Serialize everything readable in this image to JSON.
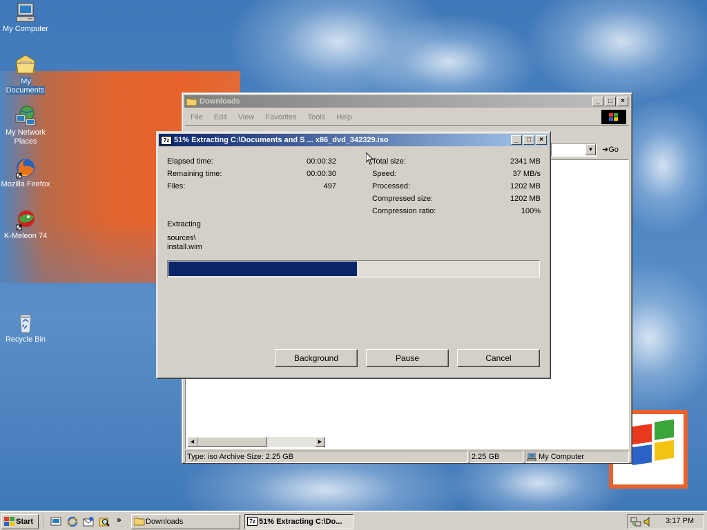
{
  "desktop": {
    "icons": [
      {
        "label": "My Computer",
        "icon": "my-computer-icon"
      },
      {
        "label": "My Documents",
        "icon": "my-documents-icon"
      },
      {
        "label": "My Network Places",
        "icon": "network-places-icon"
      },
      {
        "label": "Mozilla Firefox",
        "icon": "firefox-icon"
      },
      {
        "label": "K-Meleon 74",
        "icon": "k-meleon-icon"
      },
      {
        "label": "Recycle Bin",
        "icon": "recycle-bin-icon"
      }
    ]
  },
  "explorer": {
    "title": "Downloads",
    "menu": [
      "File",
      "Edit",
      "View",
      "Favorites",
      "Tools",
      "Help"
    ],
    "go_label": "Go",
    "status": {
      "info": "Type: iso Archive Size: 2.25 GB",
      "size": "2.25 GB",
      "zone": "My Computer"
    }
  },
  "dialog": {
    "title": "51% Extracting C:\\Documents and S ... x86_dvd_342329.iso",
    "app_badge": "7z",
    "left_stats": [
      {
        "label": "Elapsed time:",
        "value": "00:00:32"
      },
      {
        "label": "Remaining time:",
        "value": "00:00:30"
      },
      {
        "label": "Files:",
        "value": "497"
      }
    ],
    "right_stats": [
      {
        "label": "Total size:",
        "value": "2341 MB"
      },
      {
        "label": "Speed:",
        "value": "37 MB/s"
      },
      {
        "label": "Processed:",
        "value": "1202 MB"
      },
      {
        "label": "Compressed size:",
        "value": "1202 MB"
      },
      {
        "label": "Compression ratio:",
        "value": "100%"
      }
    ],
    "action": "Extracting",
    "path_line1": "sources\\",
    "path_line2": "install.wim",
    "progress": 0.51,
    "buttons": {
      "background": "Background",
      "pause": "Pause",
      "cancel": "Cancel"
    }
  },
  "taskbar": {
    "start_label": "Start",
    "items": [
      {
        "label": "Downloads",
        "icon": "folder-icon"
      },
      {
        "label": "51% Extracting C:\\Do...",
        "icon": "7zip-icon"
      }
    ],
    "clock": "3:17 PM"
  },
  "colors": {
    "accent": "#0a246a",
    "progress": "#0a246a",
    "desktop": "#3f78b8",
    "orange": "#e8632b"
  }
}
